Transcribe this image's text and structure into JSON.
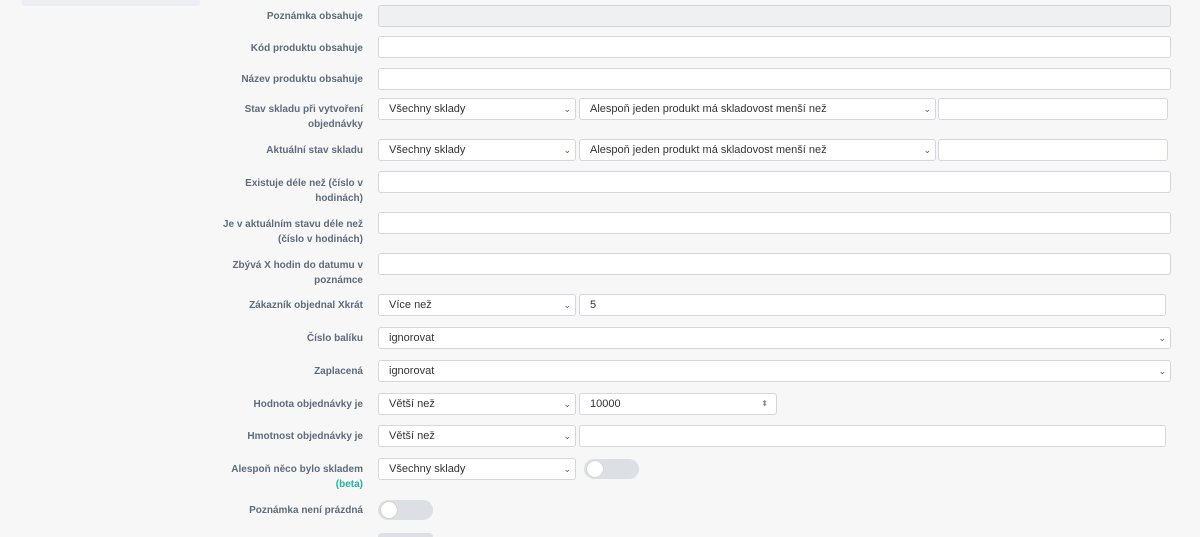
{
  "filters": {
    "note_contains": {
      "label": "Poznámka obsahuje",
      "value": ""
    },
    "product_code_contains": {
      "label": "Kód produktu obsahuje",
      "value": ""
    },
    "product_name_contains": {
      "label": "Název produktu obsahuje",
      "value": ""
    },
    "stock_at_creation": {
      "label_line1": "Stav skladu při vytvoření",
      "label_line2": "objednávky",
      "warehouse": "Všechny sklady",
      "condition": "Alespoň jeden produkt má skladovost menší než",
      "value": ""
    },
    "current_stock": {
      "label": "Aktuální stav skladu",
      "warehouse": "Všechny sklady",
      "condition": "Alespoň jeden produkt má skladovost menší než",
      "value": ""
    },
    "exists_longer": {
      "label_line1": "Existuje déle než (číslo v",
      "label_line2": "hodinách)",
      "value": ""
    },
    "in_state_longer": {
      "label_line1": "Je v aktuálním stavu déle než",
      "label_line2": "(číslo v hodinách)",
      "value": ""
    },
    "hours_to_date": {
      "label_line1": "Zbývá X hodin do datumu v",
      "label_line2": "poznámce",
      "value": ""
    },
    "customer_ordered": {
      "label": "Zákazník objednal Xkrát",
      "operator": "Více než",
      "value": "5"
    },
    "package_number": {
      "label": "Číslo balíku",
      "value": "ignorovat"
    },
    "paid": {
      "label": "Zaplacená",
      "value": "ignorovat"
    },
    "order_value": {
      "label": "Hodnota objednávky je",
      "operator": "Větší než",
      "value": "10000"
    },
    "order_weight": {
      "label": "Hmotnost objednávky je",
      "operator": "Větší než",
      "value": ""
    },
    "something_in_stock": {
      "label": "Alespoň něco bylo skladem",
      "beta": "(beta)",
      "warehouse": "Všechny sklady",
      "toggle_on": false
    },
    "note_not_empty": {
      "label": "Poznámka není prázdná",
      "toggle_on": false
    }
  },
  "colors": {
    "accent_beta": "#1fb3a4",
    "toggle_off": "#dcdfe3"
  },
  "icons": {
    "select": "chevron-down-icon",
    "number": "spinner-icon"
  }
}
